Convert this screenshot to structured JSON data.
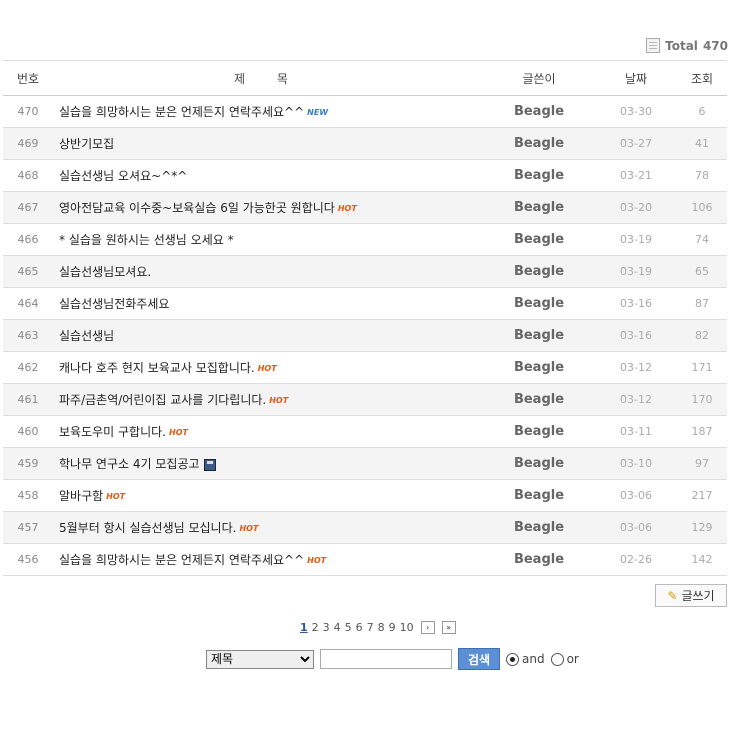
{
  "total": {
    "label": "Total",
    "count": "470"
  },
  "headers": {
    "num": "번호",
    "title": "제  목",
    "writer": "글쓴이",
    "date": "날짜",
    "views": "조회"
  },
  "rows": [
    {
      "num": "470",
      "title": "실습을 희망하시는 분은 언제든지 연락주세요^^",
      "badge": "NEW",
      "writer": "Beagle",
      "date": "03-30",
      "views": "6"
    },
    {
      "num": "469",
      "title": "상반기모집",
      "badge": "",
      "writer": "Beagle",
      "date": "03-27",
      "views": "41"
    },
    {
      "num": "468",
      "title": "실습선생님 오셔요~^*^",
      "badge": "",
      "writer": "Beagle",
      "date": "03-21",
      "views": "78"
    },
    {
      "num": "467",
      "title": "영아전담교육 이수중~보육실습 6일 가능한곳 원합니다",
      "badge": "HOT",
      "writer": "Beagle",
      "date": "03-20",
      "views": "106"
    },
    {
      "num": "466",
      "title": "* 실습을 원하시는 선생님 오세요 *",
      "badge": "",
      "writer": "Beagle",
      "date": "03-19",
      "views": "74"
    },
    {
      "num": "465",
      "title": "실습선생님모셔요.",
      "badge": "",
      "writer": "Beagle",
      "date": "03-19",
      "views": "65"
    },
    {
      "num": "464",
      "title": "실습선생님전화주세요",
      "badge": "",
      "writer": "Beagle",
      "date": "03-16",
      "views": "87"
    },
    {
      "num": "463",
      "title": "실습선생님",
      "badge": "",
      "writer": "Beagle",
      "date": "03-16",
      "views": "82"
    },
    {
      "num": "462",
      "title": "캐나다 호주 현지 보육교사 모집합니다.",
      "badge": "HOT",
      "writer": "Beagle",
      "date": "03-12",
      "views": "171"
    },
    {
      "num": "461",
      "title": "파주/금촌역/어린이집 교사를 기다립니다.",
      "badge": "HOT",
      "writer": "Beagle",
      "date": "03-12",
      "views": "170"
    },
    {
      "num": "460",
      "title": "보육도우미 구합니다.",
      "badge": "HOT",
      "writer": "Beagle",
      "date": "03-11",
      "views": "187"
    },
    {
      "num": "459",
      "title": "학나무 연구소 4기 모집공고",
      "badge": "DISK",
      "writer": "Beagle",
      "date": "03-10",
      "views": "97"
    },
    {
      "num": "458",
      "title": "알바구함",
      "badge": "HOT",
      "writer": "Beagle",
      "date": "03-06",
      "views": "217"
    },
    {
      "num": "457",
      "title": "5월부터 항시 실습선생님 모십니다.",
      "badge": "HOT",
      "writer": "Beagle",
      "date": "03-06",
      "views": "129"
    },
    {
      "num": "456",
      "title": "실습을 희망하시는 분은 언제든지 연락주세요^^",
      "badge": "HOT",
      "writer": "Beagle",
      "date": "02-26",
      "views": "142"
    }
  ],
  "write_button": "글쓰기",
  "pager": {
    "pages": [
      "1",
      "2",
      "3",
      "4",
      "5",
      "6",
      "7",
      "8",
      "9",
      "10"
    ],
    "current": "1"
  },
  "search": {
    "field_selected": "제목",
    "button": "검색",
    "opt_and": "and",
    "opt_or": "or"
  }
}
